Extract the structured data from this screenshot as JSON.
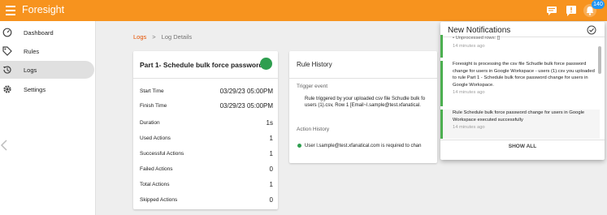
{
  "app": {
    "title": "Foresight"
  },
  "topbar": {
    "notification_count": "140"
  },
  "sidebar": {
    "items": [
      {
        "label": "Dashboard",
        "icon": "dashboard-icon"
      },
      {
        "label": "Rules",
        "icon": "rules-icon"
      },
      {
        "label": "Logs",
        "icon": "history-icon",
        "active": true
      },
      {
        "label": "Settings",
        "icon": "gear-icon"
      }
    ]
  },
  "breadcrumb": {
    "link": "Logs",
    "separator": ">",
    "current": "Log Details"
  },
  "summary_card": {
    "title": "Part 1- Schedule bulk force password chan",
    "rows": [
      {
        "label": "Start Time",
        "value": "03/29/23 05:00PM"
      },
      {
        "label": "Finish Time",
        "value": "03/29/23 05:00PM"
      },
      {
        "label": "Duration",
        "value": "1s"
      },
      {
        "label": "Used Actions",
        "value": "1"
      },
      {
        "label": "Successful Actions",
        "value": "1"
      },
      {
        "label": "Failed Actions",
        "value": "0"
      },
      {
        "label": "Total Actions",
        "value": "1"
      },
      {
        "label": "Skipped Actions",
        "value": "0"
      }
    ]
  },
  "rule_history": {
    "title": "Rule History",
    "trigger_label": "Trigger event",
    "trigger_line1": "Rule triggered by your uploaded csv file Schudle bulk fo",
    "trigger_line2": "users (1).csv, Row 1 [Email~l.sample@test.xfanatical.",
    "action_label": "Action History",
    "action_text": "User l.sample@test.xfanatical.com is required to chan"
  },
  "notifications": {
    "title": "New Notifications",
    "items": [
      {
        "message": "• Unprocessed rows: []",
        "time": "14 minutes ago"
      },
      {
        "message": "Foresight is processing the csv file Schudle bulk force password change for users in Google Workspace - users (1).csv you uploaded to rule Part 1 - Schedule bulk force password change for users in Google Workspace.",
        "time": "14 minutes ago"
      },
      {
        "message": "Rule Schedule bulk force password change for users in Google Workspace executed successfully",
        "time": "14 minutes ago"
      }
    ],
    "show_all": "SHOW ALL"
  },
  "colors": {
    "brand": "#f7931e",
    "success": "#2e9e4f",
    "badge": "#2196f3"
  }
}
